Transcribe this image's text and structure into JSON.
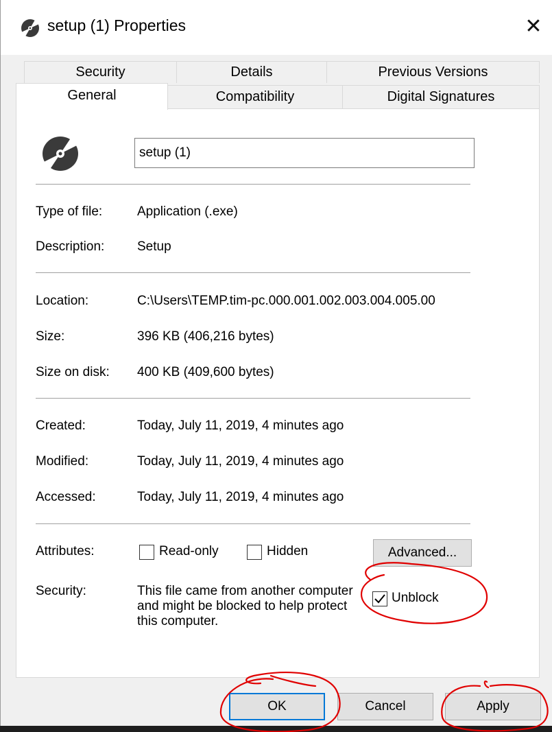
{
  "window": {
    "title": "setup (1) Properties",
    "close_glyph": "✕"
  },
  "tabs": {
    "row_back": [
      "Security",
      "Details",
      "Previous Versions"
    ],
    "row_front": [
      "General",
      "Compatibility",
      "Digital Signatures"
    ],
    "active": "General"
  },
  "general": {
    "file_name": "setup (1)",
    "type_label": "Type of file:",
    "type_value": "Application (.exe)",
    "description_label": "Description:",
    "description_value": "Setup",
    "location_label": "Location:",
    "location_value": "C:\\Users\\TEMP.tim-pc.000.001.002.003.004.005.00",
    "size_label": "Size:",
    "size_value": "396 KB (406,216 bytes)",
    "size_on_disk_label": "Size on disk:",
    "size_on_disk_value": "400 KB (409,600 bytes)",
    "created_label": "Created:",
    "created_value": "Today, July 11, 2019, 4 minutes ago",
    "modified_label": "Modified:",
    "modified_value": "Today, July 11, 2019, 4 minutes ago",
    "accessed_label": "Accessed:",
    "accessed_value": "Today, July 11, 2019, 4 minutes ago",
    "attributes_label": "Attributes:",
    "readonly_label": "Read-only",
    "readonly_checked": false,
    "hidden_label": "Hidden",
    "hidden_checked": false,
    "advanced_label": "Advanced...",
    "security_label": "Security:",
    "security_text": "This file came from another computer and might be blocked to help protect this computer.",
    "unblock_label": "Unblock",
    "unblock_checked": true
  },
  "buttons": {
    "ok": "OK",
    "cancel": "Cancel",
    "apply": "Apply"
  },
  "colors": {
    "focus_border": "#0078d7",
    "annotation": "#e00000",
    "window_bg": "#f0f0f0",
    "panel_bg": "#ffffff"
  }
}
